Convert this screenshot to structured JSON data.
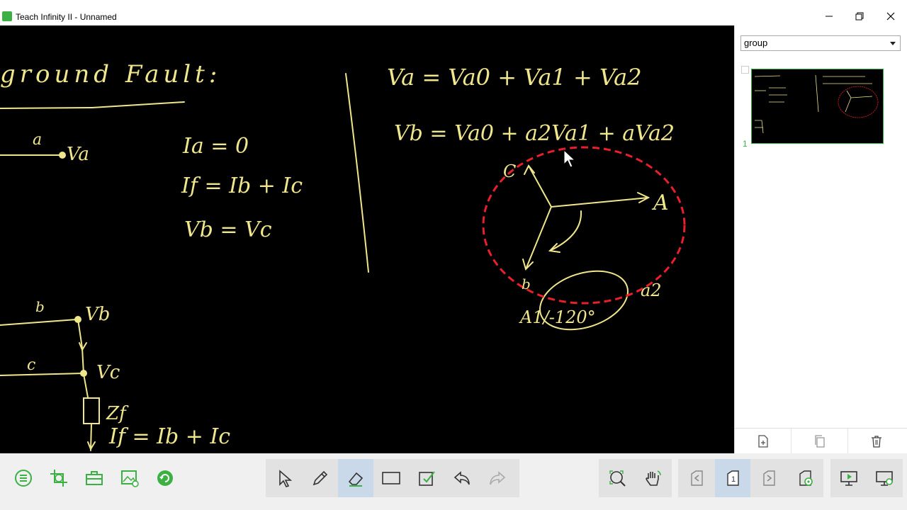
{
  "window": {
    "title": "Teach Infinity II - Unnamed",
    "controls": [
      "minimize-icon",
      "restore-icon",
      "close-icon"
    ]
  },
  "board": {
    "background": "#000000",
    "ink_color": "#f0e68c",
    "accent_color": "#e8202a",
    "heading": "ground Fault:",
    "conditions": [
      "Ia = 0",
      "If = Ib + Ic",
      "Vb = Vc"
    ],
    "equations": [
      "Va = Va0 + Va1 + Va2",
      "Vb = Va0 + a2Va1 + aVa2"
    ],
    "phase_labels": {
      "a": "a",
      "va": "Va",
      "b": "b",
      "vb": "Vb",
      "c": "c",
      "vc": "Vc",
      "zf": "Zf"
    },
    "fault_current": "If = Ib + Ic",
    "phasor_labels": {
      "a_tip": "A",
      "c": "C",
      "b": "b",
      "rotation": "A1/-120°",
      "alpha": "a2"
    }
  },
  "sidebar": {
    "group_select": "group",
    "page_number": "1",
    "buttons": [
      "add-page-icon",
      "duplicate-page-icon",
      "delete-page-icon"
    ]
  },
  "toolbar": {
    "left": [
      "menu-icon",
      "crop-icon",
      "toolbox-icon",
      "gallery-icon",
      "refresh-icon"
    ],
    "center": [
      "pointer-icon",
      "pen-icon",
      "eraser-icon",
      "rectangle-icon",
      "check-box-icon",
      "undo-icon",
      "redo-icon"
    ],
    "active_tool": "eraser",
    "right": [
      "zoom-icon",
      "pan-hand-icon",
      "prev-page-icon",
      "page-one-icon",
      "next-page-icon",
      "page-settings-icon",
      "present-icon",
      "screen-settings-icon"
    ],
    "page_indicator": "1",
    "accent_color": "#3cb043"
  }
}
